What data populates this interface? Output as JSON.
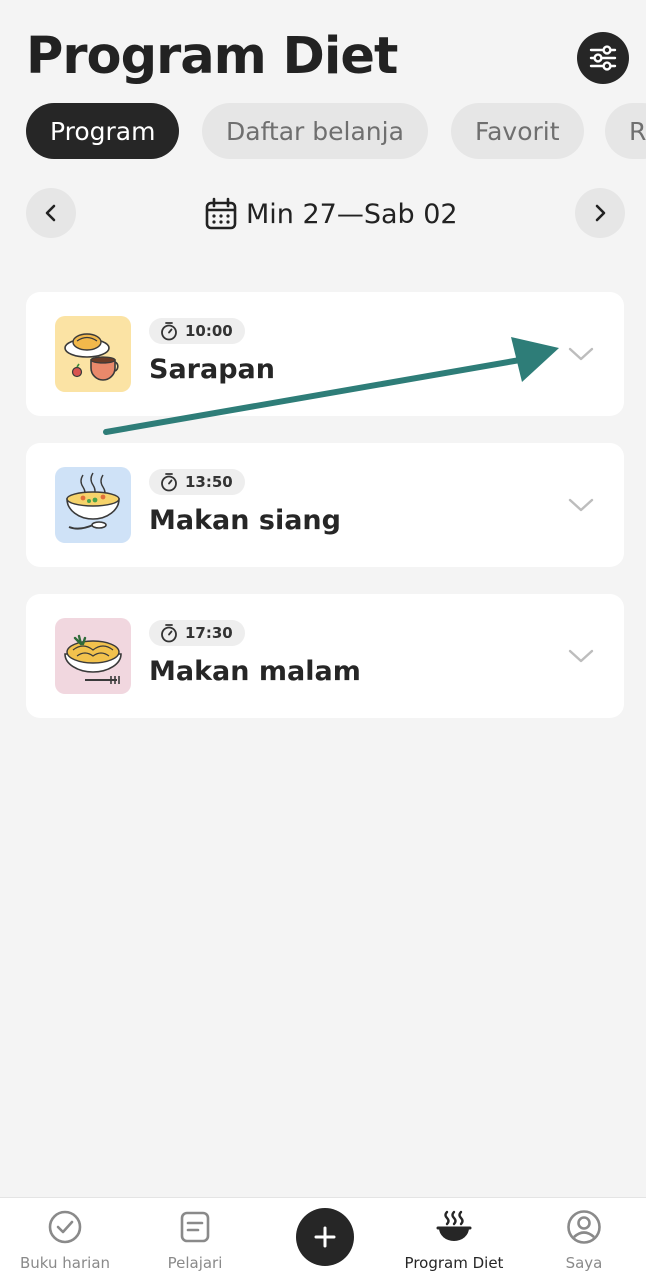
{
  "header": {
    "title": "Program Diet",
    "filter_icon": "sliders-icon"
  },
  "tabs": [
    {
      "label": "Program",
      "active": true
    },
    {
      "label": "Daftar belanja",
      "active": false
    },
    {
      "label": "Favorit",
      "active": false
    },
    {
      "label": "R",
      "active": false
    }
  ],
  "week": {
    "label": "Min 27—Sab 02",
    "icon": "calendar-icon",
    "prev_icon": "chevron-left-icon",
    "next_icon": "chevron-right-icon"
  },
  "meals": [
    {
      "time": "10:00",
      "name": "Sarapan",
      "image": "breakfast-illustration",
      "thumb_color": "#fbe3a4"
    },
    {
      "time": "13:50",
      "name": "Makan siang",
      "image": "soup-illustration",
      "thumb_color": "#cfe2f7"
    },
    {
      "time": "17:30",
      "name": "Makan malam",
      "image": "pasta-illustration",
      "thumb_color": "#f1d7df"
    }
  ],
  "annotation": {
    "color": "#2e7d78",
    "icon": "arrow-annotation"
  },
  "bottom_nav": [
    {
      "label": "Buku harian",
      "icon": "check-circle-icon",
      "active": false
    },
    {
      "label": "Pelajari",
      "icon": "article-icon",
      "active": false
    },
    {
      "label": "",
      "icon": "plus-icon",
      "active": false
    },
    {
      "label": "Program Diet",
      "icon": "food-bowl-icon",
      "active": true
    },
    {
      "label": "Saya",
      "icon": "profile-icon",
      "active": false
    }
  ]
}
